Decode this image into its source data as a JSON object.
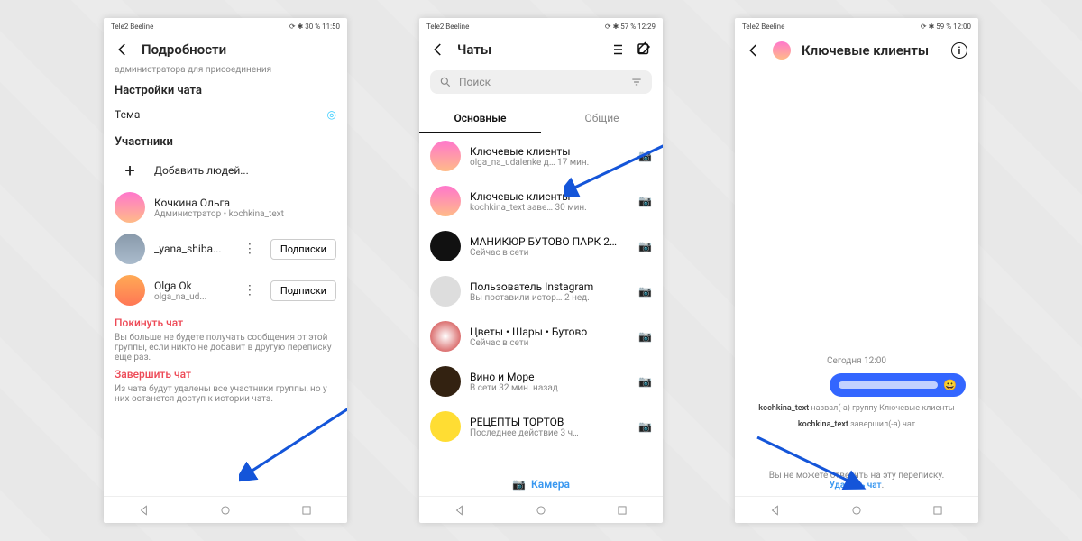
{
  "status": {
    "left": "Tele2  Beeline",
    "batt1": "⟳ ✱ 30 %  11:50",
    "batt2": "⟳ ✱ 57 %  12:29",
    "batt3": "⟳ ✱ 59 %  12:00"
  },
  "p1": {
    "title": "Подробности",
    "admin_note": "администратора для присоединения",
    "settings": "Настройки чата",
    "theme": "Тема",
    "members": "Участники",
    "add": "Добавить людей...",
    "u1_name": "Кочкина Ольга",
    "u1_sub": "Администратор • kochkina_text",
    "u2_name": "_yana_shiba...",
    "u3_name": "Olga Ok",
    "u3_sub": "olga_na_ud...",
    "follow": "Подписки",
    "leave_t": "Покинуть чат",
    "leave_d": "Вы больше не будете получать сообщения от этой группы, если никто не добавит в другую переписку еще раз.",
    "end_t": "Завершить чат",
    "end_d": "Из чата будут удалены все участники группы, но у них останется доступ к истории чата."
  },
  "p2": {
    "title": "Чаты",
    "search": "Поиск",
    "tab1": "Основные",
    "tab2": "Общие",
    "chats": [
      {
        "n": "Ключевые клиенты",
        "s": "olga_na_udalenke д…   17 мин."
      },
      {
        "n": "Ключевые клиенты",
        "s": "kochkina_text заве…   30 мин."
      },
      {
        "n": "МАНИКЮР БУТОВО ПАРК 2…",
        "s": "Сейчас в сети"
      },
      {
        "n": "Пользователь Instagram",
        "s": "Вы поставили истор…   2 нед."
      },
      {
        "n": "Цветы • Шары • Бутово",
        "s": "Сейчас в сети"
      },
      {
        "n": "Вино и Море",
        "s": "В сети 32 мин. назад"
      },
      {
        "n": "РЕЦЕПТЫ ТОРТОВ",
        "s": "Последнее действие 3 ч…"
      }
    ],
    "camera": "Камера"
  },
  "p3": {
    "title": "Ключевые клиенты",
    "date": "Сегодня 12:00",
    "sys1_u": "kochkina_text",
    "sys1_t": " назвал(-а) группу Ключевые клиенты",
    "sys2_u": "kochkina_text",
    "sys2_t": " завершил(-а) чат",
    "foot1": "Вы не можете ответить на эту переписку.",
    "foot_link": "Удалить чат"
  }
}
